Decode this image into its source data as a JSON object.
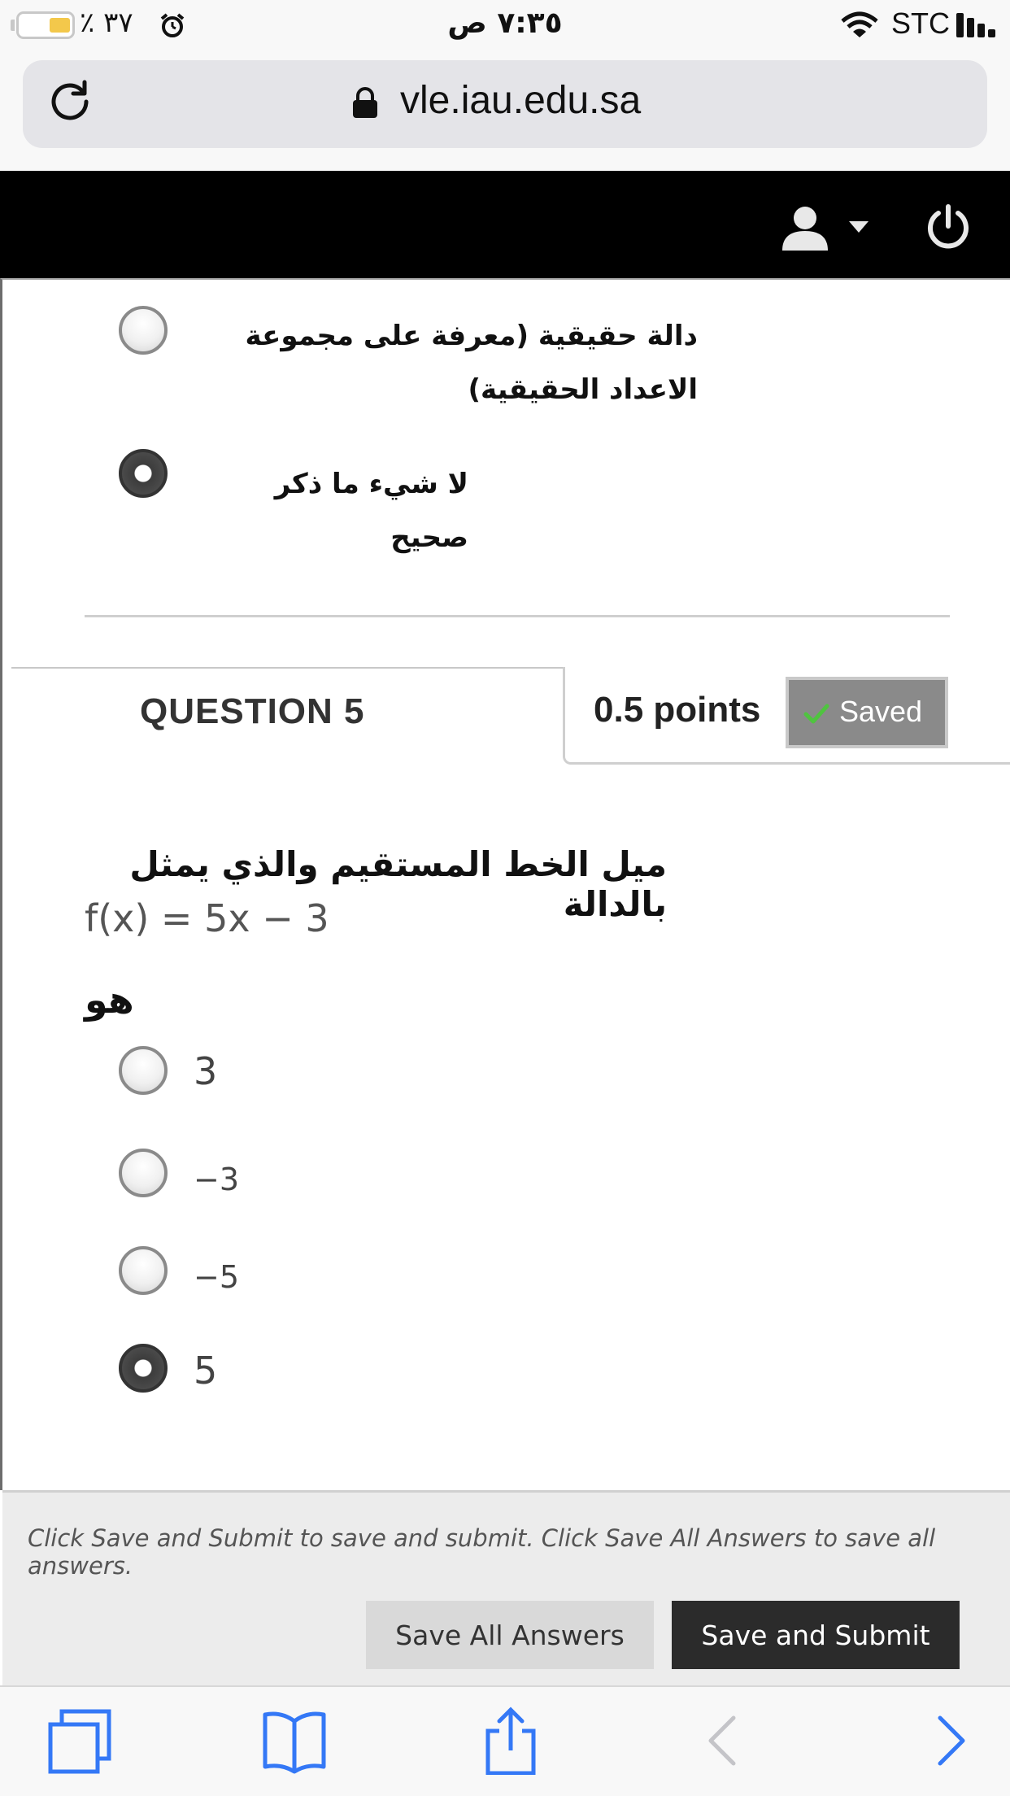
{
  "status_bar": {
    "battery_text": "٪ ٣٧",
    "time": "٧:٣٥ ص",
    "carrier": "STC"
  },
  "browser": {
    "url": "vle.iau.edu.sa"
  },
  "previous_question": {
    "options": [
      {
        "label": "دالة حقيقية (معرفة على مجموعة الاعداد الحقيقية)",
        "selected": false
      },
      {
        "label": "لا شيء ما ذكر صحيح",
        "selected": true
      }
    ]
  },
  "question": {
    "title": "QUESTION 5",
    "points": "0.5 points",
    "status": "Saved",
    "text_ar": "ميل الخط المستقيم والذي يمثل بالدالة",
    "formula": "f(x) = 5x − 3",
    "text_ar_end": "هو",
    "answers": [
      {
        "label": "3",
        "selected": false
      },
      {
        "label": "−3",
        "selected": false
      },
      {
        "label": "−5",
        "selected": false
      },
      {
        "label": "5",
        "selected": true
      }
    ]
  },
  "submit_bar": {
    "help_text": "Click Save and Submit to save and submit. Click Save All Answers to save all answers.",
    "save_all_label": "Save All Answers",
    "save_submit_label": "Save and Submit"
  },
  "colors": {
    "header_bg": "#000000",
    "saved_badge_bg": "#8a8a8a",
    "primary_button_bg": "#2b2b2b",
    "toolbar_icon": "#3478f6"
  },
  "icons": [
    "battery-icon",
    "alarm-icon",
    "wifi-icon",
    "signal-icon",
    "reload-icon",
    "lock-icon",
    "user-icon",
    "power-icon",
    "check-icon",
    "tabs-icon",
    "bookmarks-icon",
    "share-icon",
    "back-icon",
    "forward-icon"
  ]
}
